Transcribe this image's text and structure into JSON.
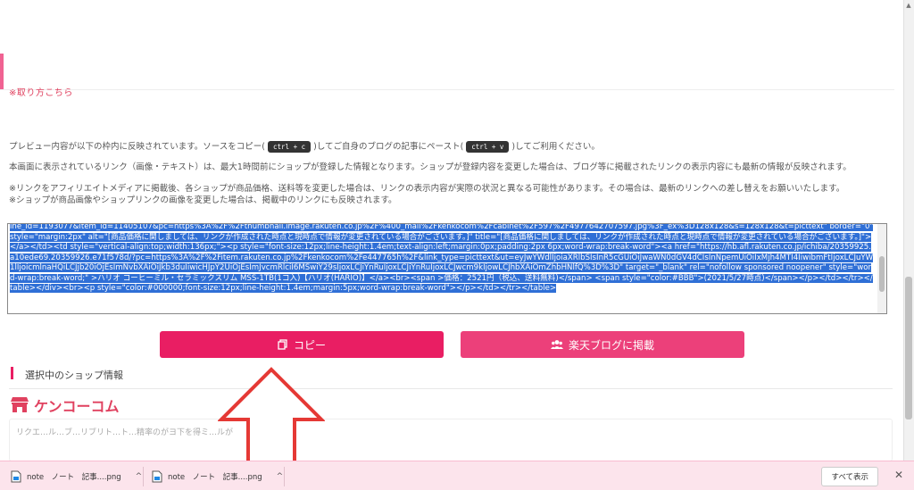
{
  "content": {
    "cut_heading": "※取り方こちら",
    "preview_text_1": "プレビュー内容が以下の枠内に反映されています。ソースをコピー(",
    "kbd_copy": "ctrl + c",
    "preview_text_2": ")してご自身のブログの記事にペースト(",
    "kbd_paste": "ctrl + v",
    "preview_text_3": ")してご利用ください。",
    "notice_1": "本画面に表示されているリンク（画像・テキスト）は、最大1時間前にショップが登録した情報となります。ショップが登録内容を変更した場合は、ブログ等に掲載されたリンクの表示内容にも最新の情報が反映されます。",
    "notice_2": "※リンクをアフィリエイトメディアに掲載後、各ショップが商品価格、送料等を変更した場合は、リンクの表示内容が実際の状況と異なる可能性があります。その場合は、最新のリンクへの差し替えをお願いいたします。",
    "notice_3": "※ショップが商品画像やショップリンクの画像を変更した場合は、掲載中のリンクにも反映されます。"
  },
  "code": {
    "line_1": "ine_id=1193077&item_id=11405107&pc=https%3A%2F%2Fthumbnail.image.rakuten.co.jp%2F%400_mall%2Fkenkocom%2Fcabinet%2F597%2F4977642707597.jpg%3F_ex%3D128x128&s=128x128&t=picttext\" border=\"0\" style=\"margin:2px\" alt=\"[商品価格に関しましては、リンクが作成された時点と現時点で情報が変更されている場合がございます。]\" title=\"[商品価格に関しましては、リンクが作成された時点と現時点で情報が変更されている場合がございます。]\"></a></td><td style=\"vertical-align:top;width:136px;\"><p style=\"font-size:12px;line-height:1.4em;text-align:left;margin:0px;padding:2px 6px;word-wrap:break-word\"><a href=\"https://hb.afl.rakuten.co.jp/ichiba/20359925.a10ede69.20359926.e71f578d/?pc=https%3A%2F%2Fitem.rakuten.co.jp%2Fkenkocom%2Fe447765h%2F&link_type=picttext&ut=eyJwYWdlIjoiaXRlbSIsInR5cGUiOiJwaWN0dGV4dCIsInNpemUiOiIxMjh4MTI4IiwibmFtIjoxLCJuYW1lIjoicmlnaHQiLCJjb20iOjEsImNvbXAiOiJkb3duIiwicHJpY2UiOjEsImJvcmRlciI6MSwiY29sIjoxLCJiYnRuIjoxLCJiYnRuIjoxLCJwcm9kIjowLCJhbXAiOmZhbHNlfQ%3D%3D\" target=\"_blank\" rel=\"nofollow sponsored noopener\" style=\"word-wrap:break-word;\" >ハリオ コーヒーミル・セラミックスリム MSS-1TB(1コ入)【ハリオ(HARIO)】</a><br><span >価格：2521円（税込、送料無料)</span> <span style=\"color:#BBB\">(2021/5/27時点)</span></p></td></tr></table></div><br><p style=\"color:#000000;font-size:12px;line-height:1.4em;margin:5px;word-wrap:break-word\"></p></td></tr></table>"
  },
  "buttons": {
    "copy_label": "コピー",
    "rakuten_label": "楽天ブログに掲載"
  },
  "shop": {
    "section_title": "選択中のショップ情報",
    "name": "ケンコーコム",
    "description": "リクエ…ル…ブ…リブリト…ト…精率のがヨ下を得ミ…ルが"
  },
  "downloads": {
    "items": [
      {
        "filename": "note　ノート　記事....png"
      },
      {
        "filename": "note　ノート　記事....png"
      }
    ],
    "show_all": "すべて表示"
  },
  "colors": {
    "accent": "#e91e63",
    "accent_light": "#ec407a",
    "shop_red": "#e0415f",
    "selection": "#2f6fd6"
  }
}
